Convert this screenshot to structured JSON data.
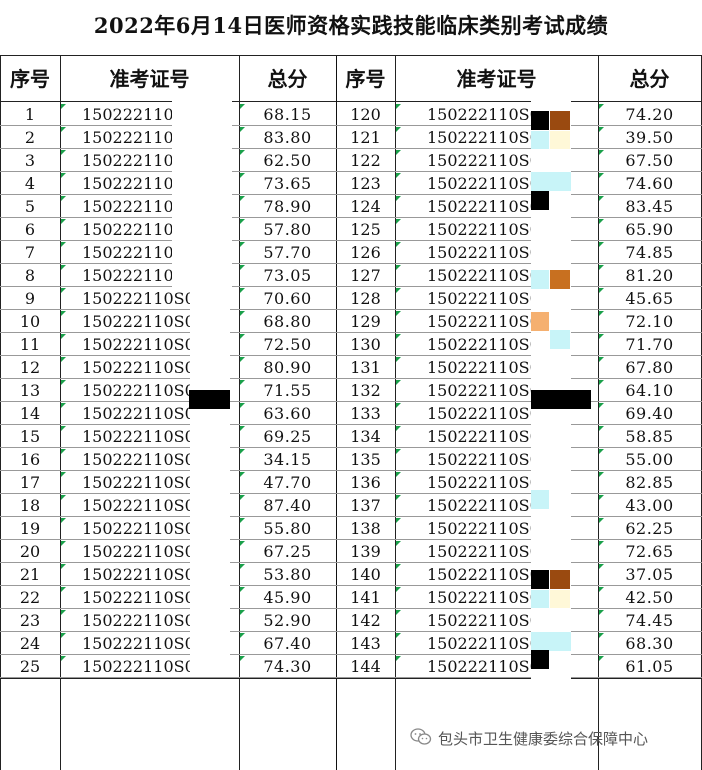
{
  "title": "2022年6月14日医师资格实践技能临床类别考试成绩",
  "headers": {
    "seq": "序号",
    "id": "准考证号",
    "score": "总分"
  },
  "left_rows": [
    {
      "seq": "1",
      "id": "150222110",
      "score": "68.15"
    },
    {
      "seq": "2",
      "id": "150222110",
      "score": "83.80"
    },
    {
      "seq": "3",
      "id": "150222110",
      "score": "62.50"
    },
    {
      "seq": "4",
      "id": "150222110",
      "score": "73.65"
    },
    {
      "seq": "5",
      "id": "150222110",
      "score": "78.90"
    },
    {
      "seq": "6",
      "id": "150222110",
      "score": "57.80"
    },
    {
      "seq": "7",
      "id": "150222110",
      "score": "57.70"
    },
    {
      "seq": "8",
      "id": "150222110S0",
      "score": "73.05"
    },
    {
      "seq": "9",
      "id": "150222110S0",
      "score": "70.60"
    },
    {
      "seq": "10",
      "id": "150222110S0",
      "score": "68.80"
    },
    {
      "seq": "11",
      "id": "150222110S0",
      "score": "72.50"
    },
    {
      "seq": "12",
      "id": "150222110S0",
      "score": "80.90"
    },
    {
      "seq": "13",
      "id": "150222110S0",
      "score": "71.55"
    },
    {
      "seq": "14",
      "id": "150222110S0",
      "score": "63.60"
    },
    {
      "seq": "15",
      "id": "150222110S0",
      "score": "69.25"
    },
    {
      "seq": "16",
      "id": "150222110S0",
      "score": "34.15"
    },
    {
      "seq": "17",
      "id": "150222110S0",
      "score": "47.70"
    },
    {
      "seq": "18",
      "id": "150222110S0",
      "score": "87.40"
    },
    {
      "seq": "19",
      "id": "150222110S0",
      "score": "55.80"
    },
    {
      "seq": "20",
      "id": "150222110S0",
      "score": "67.25"
    },
    {
      "seq": "21",
      "id": "150222110S0",
      "score": "53.80"
    },
    {
      "seq": "22",
      "id": "150222110S0",
      "score": "45.90"
    },
    {
      "seq": "23",
      "id": "150222110S0",
      "score": "52.90"
    },
    {
      "seq": "24",
      "id": "150222110S0",
      "score": "67.40"
    },
    {
      "seq": "25",
      "id": "150222110S0",
      "score": "74.30"
    }
  ],
  "right_rows": [
    {
      "seq": "120",
      "id": "150222110S0",
      "score": "74.20"
    },
    {
      "seq": "121",
      "id": "150222110S0",
      "score": "39.50"
    },
    {
      "seq": "122",
      "id": "150222110S0",
      "score": "67.50"
    },
    {
      "seq": "123",
      "id": "150222110S0",
      "score": "74.60"
    },
    {
      "seq": "124",
      "id": "150222110S0",
      "score": "83.45"
    },
    {
      "seq": "125",
      "id": "150222110S0",
      "score": "65.90"
    },
    {
      "seq": "126",
      "id": "150222110S0",
      "score": "74.85"
    },
    {
      "seq": "127",
      "id": "150222110S0",
      "score": "81.20"
    },
    {
      "seq": "128",
      "id": "150222110S0",
      "score": "45.65"
    },
    {
      "seq": "129",
      "id": "150222110S0",
      "score": "72.10"
    },
    {
      "seq": "130",
      "id": "150222110S0",
      "score": "71.70"
    },
    {
      "seq": "131",
      "id": "150222110S0",
      "score": "67.80"
    },
    {
      "seq": "132",
      "id": "150222110S0",
      "score": "64.10"
    },
    {
      "seq": "133",
      "id": "150222110S0",
      "score": "69.40"
    },
    {
      "seq": "134",
      "id": "150222110S0",
      "score": "58.85"
    },
    {
      "seq": "135",
      "id": "150222110S0",
      "score": "55.00"
    },
    {
      "seq": "136",
      "id": "150222110S0",
      "score": "82.85"
    },
    {
      "seq": "137",
      "id": "150222110S0",
      "score": "43.00"
    },
    {
      "seq": "138",
      "id": "150222110S0",
      "score": "62.25"
    },
    {
      "seq": "139",
      "id": "150222110S0",
      "score": "72.65"
    },
    {
      "seq": "140",
      "id": "150222110S0",
      "score": "37.05"
    },
    {
      "seq": "141",
      "id": "150222110S0",
      "score": "42.50"
    },
    {
      "seq": "142",
      "id": "150222110S0",
      "score": "74.45"
    },
    {
      "seq": "143",
      "id": "150222110S0",
      "score": "68.30"
    },
    {
      "seq": "144",
      "id": "150222110S0",
      "score": "61.05"
    }
  ],
  "footer": {
    "icon": "wechat-icon",
    "text": "包头市卫生健康委综合保障中心"
  },
  "colors": {
    "grid": "#222222",
    "triangle": "#1aa04a",
    "mask_white": "#ffffff",
    "mask_black": "#000000",
    "mask_brown": "#9a4a10",
    "mask_orange": "#c87020",
    "mask_peach": "#f5b070",
    "mask_cyan": "#c8f4f8",
    "mask_cream": "#fff8d8"
  }
}
